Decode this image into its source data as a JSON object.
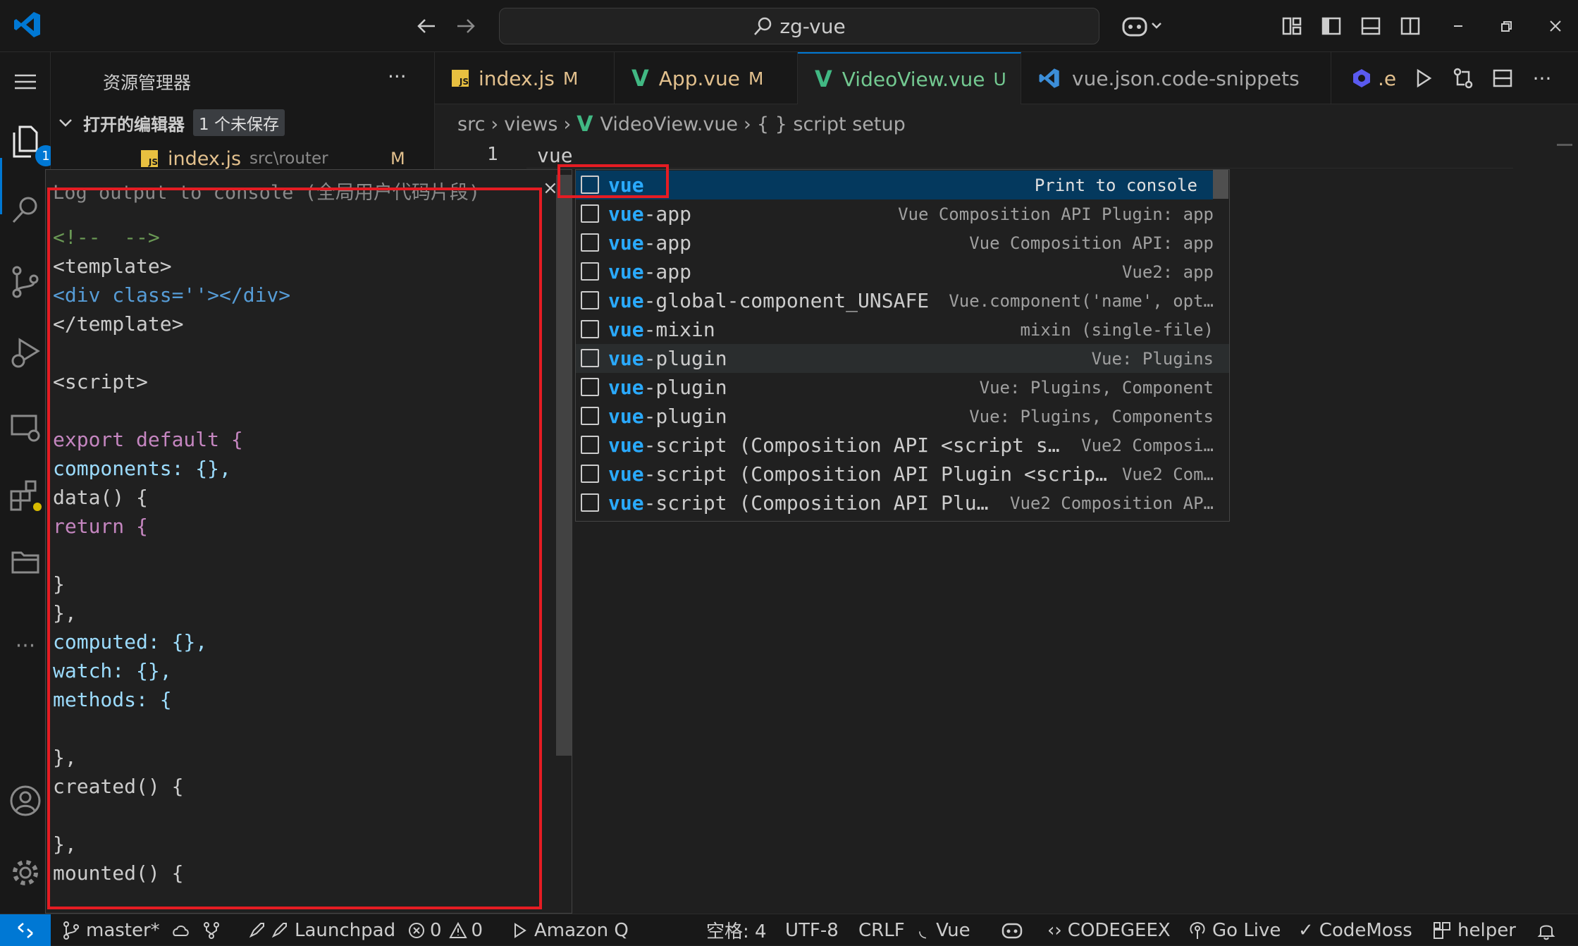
{
  "titlebar": {
    "search": "zg-vue"
  },
  "sidebar": {
    "title": "资源管理器",
    "more": "···",
    "open_editors_label": "打开的编辑器",
    "unsaved_badge": "1 个未保存",
    "open_file_name": "index.js",
    "open_file_path": "src\\router",
    "open_file_status": "M",
    "explorer_badge": "1"
  },
  "tabs": [
    {
      "name": "index.js",
      "status": "M",
      "icon": "js-file-icon"
    },
    {
      "name": "App.vue",
      "status": "M",
      "icon": "vue-file-icon"
    },
    {
      "name": "VideoView.vue",
      "status": "U",
      "icon": "vue-file-icon"
    },
    {
      "name": "vue.json.code-snippets",
      "status": "",
      "icon": "vscode-icon"
    },
    {
      "name": ".e",
      "status": "",
      "icon": "hexagon-icon"
    }
  ],
  "breadcrumb": {
    "parts": [
      "src",
      "views",
      "VideoView.vue",
      "{ } script setup"
    ]
  },
  "editor": {
    "line_number": "1",
    "line_text": "vue"
  },
  "snippet_detail": {
    "description": "Log output to console (全局用户代码片段)",
    "lines": [
      "<!--  -->",
      "<template>",
      "<div class=''></div>",
      "</template>",
      "",
      "<script>",
      "",
      "export default {",
      "components: {},",
      "data() {",
      "return {",
      "",
      "}",
      "},",
      "computed: {},",
      "watch: {},",
      "methods: {",
      "",
      "},",
      "created() {",
      "",
      "},",
      "mounted() {"
    ]
  },
  "suggestions": [
    {
      "prefix": "vue",
      "rest": "",
      "detail": "Print to console"
    },
    {
      "prefix": "vue",
      "rest": "-app",
      "detail": "Vue Composition API Plugin: app"
    },
    {
      "prefix": "vue",
      "rest": "-app",
      "detail": "Vue Composition API: app"
    },
    {
      "prefix": "vue",
      "rest": "-app",
      "detail": "Vue2: app"
    },
    {
      "prefix": "vue",
      "rest": "-global-component_UNSAFE",
      "detail": "Vue.component('name', opt…"
    },
    {
      "prefix": "vue",
      "rest": "-mixin",
      "detail": "mixin (single-file)"
    },
    {
      "prefix": "vue",
      "rest": "-plugin",
      "detail": "Vue: Plugins"
    },
    {
      "prefix": "vue",
      "rest": "-plugin",
      "detail": "Vue: Plugins, Component"
    },
    {
      "prefix": "vue",
      "rest": "-plugin",
      "detail": "Vue: Plugins, Components"
    },
    {
      "prefix": "vue",
      "rest": "-script (Composition API <script s…",
      "detail": "Vue2 Composi…"
    },
    {
      "prefix": "vue",
      "rest": "-script (Composition API Plugin <scrip…",
      "detail": "Vue2 Com…"
    },
    {
      "prefix": "vue",
      "rest": "-script (Composition API Plu…",
      "detail": "Vue2 Composition AP…"
    }
  ],
  "statusbar": {
    "branch": "master*",
    "launchpad": "Launchpad",
    "errors": "0",
    "warnings": "0",
    "amazon_q": "Amazon Q",
    "spaces": "空格: 4",
    "encoding": "UTF-8",
    "eol": "CRLF",
    "language": "Vue",
    "codegeex": "CODEGEEX",
    "go_live": "Go Live",
    "codemoss": "CodeMoss",
    "helper": "helper"
  },
  "colors": {
    "accent": "#0078d4",
    "highlight_match": "#2aaaff",
    "focused_row": "#04395e",
    "annotation_red": "#e51c23",
    "vue_green": "#41b883",
    "modified_orange": "#e2c08d"
  }
}
